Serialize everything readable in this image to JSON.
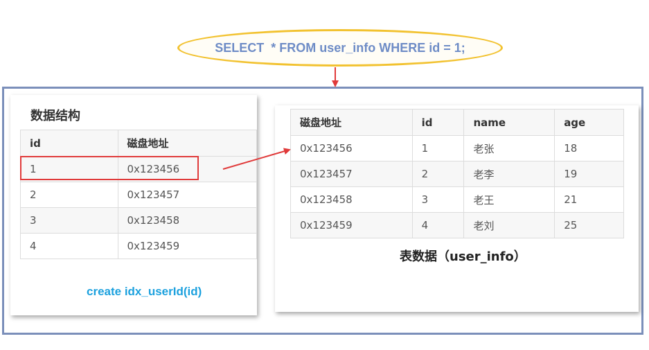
{
  "query": {
    "text": "SELECT  * FROM user_info WHERE id = 1;"
  },
  "index_panel": {
    "title": "数据结构",
    "headers": [
      "id",
      "磁盘地址"
    ],
    "rows": [
      [
        "1",
        "0x123456"
      ],
      [
        "2",
        "0x123457"
      ],
      [
        "3",
        "0x123458"
      ],
      [
        "4",
        "0x123459"
      ]
    ],
    "caption": "create idx_userId(id)"
  },
  "data_panel": {
    "headers": [
      "磁盘地址",
      "id",
      "name",
      "age"
    ],
    "rows": [
      [
        "0x123456",
        "1",
        "老张",
        "18"
      ],
      [
        "0x123457",
        "2",
        "老李",
        "19"
      ],
      [
        "0x123458",
        "3",
        "老王",
        "21"
      ],
      [
        "0x123459",
        "4",
        "老刘",
        "25"
      ]
    ],
    "caption": "表数据（user_info）"
  },
  "colors": {
    "ellipse_border": "#f2c230",
    "query_text": "#6e8cc6",
    "frame_border": "#7b8fba",
    "arrow": "#e03a3a",
    "index_caption": "#1ca1de"
  }
}
